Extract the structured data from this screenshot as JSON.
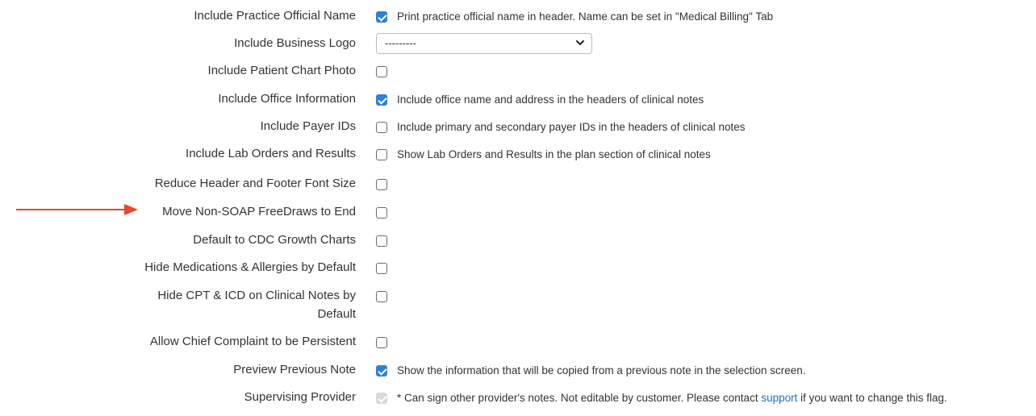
{
  "rows": [
    {
      "label": "Include Practice Official Name",
      "checked": true,
      "help": "Print practice official name in header. Name can be set in \"Medical Billing\" Tab"
    },
    {
      "label": "Include Business Logo",
      "select_value": "---------"
    },
    {
      "label": "Include Patient Chart Photo",
      "checked": false
    },
    {
      "label": "Include Office Information",
      "checked": true,
      "help": "Include office name and address in the headers of clinical notes"
    },
    {
      "label": "Include Payer IDs",
      "checked": false,
      "help": "Include primary and secondary payer IDs in the headers of clinical notes"
    },
    {
      "label": "Include Lab Orders and Results",
      "checked": false,
      "help": "Show Lab Orders and Results in the plan section of clinical notes"
    },
    {
      "label": "Reduce Header and Footer Font Size",
      "checked": false
    },
    {
      "label": "Move Non-SOAP FreeDraws to End",
      "checked": false
    },
    {
      "label": "Default to CDC Growth Charts",
      "checked": false
    },
    {
      "label": "Hide Medications & Allergies by Default",
      "checked": false
    },
    {
      "label_line1": "Hide CPT & ICD on Clinical Notes by",
      "label_line2": "Default",
      "checked": false
    },
    {
      "label": "Allow Chief Complaint to be Persistent",
      "checked": false
    },
    {
      "label": "Preview Previous Note",
      "checked": true,
      "help": "Show the information that will be copied from a previous note in the selection screen."
    },
    {
      "label": "Supervising Provider",
      "checked": true,
      "disabled": true,
      "help_before": "* Can sign other provider's notes. Not editable by customer. Please contact ",
      "help_link": "support",
      "help_after": " if you want to change this flag."
    }
  ],
  "annotation": {
    "arrow_color": "#e8472a"
  },
  "colors": {
    "checkbox_checked": "#2f7fd9",
    "link": "#1a6fc7"
  }
}
